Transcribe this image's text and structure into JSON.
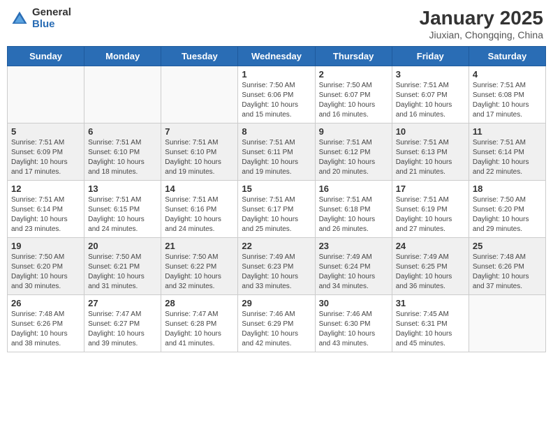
{
  "header": {
    "logo_general": "General",
    "logo_blue": "Blue",
    "title": "January 2025",
    "location": "Jiuxian, Chongqing, China"
  },
  "weekdays": [
    "Sunday",
    "Monday",
    "Tuesday",
    "Wednesday",
    "Thursday",
    "Friday",
    "Saturday"
  ],
  "weeks": [
    [
      {
        "day": "",
        "info": ""
      },
      {
        "day": "",
        "info": ""
      },
      {
        "day": "",
        "info": ""
      },
      {
        "day": "1",
        "info": "Sunrise: 7:50 AM\nSunset: 6:06 PM\nDaylight: 10 hours and 15 minutes."
      },
      {
        "day": "2",
        "info": "Sunrise: 7:50 AM\nSunset: 6:07 PM\nDaylight: 10 hours and 16 minutes."
      },
      {
        "day": "3",
        "info": "Sunrise: 7:51 AM\nSunset: 6:07 PM\nDaylight: 10 hours and 16 minutes."
      },
      {
        "day": "4",
        "info": "Sunrise: 7:51 AM\nSunset: 6:08 PM\nDaylight: 10 hours and 17 minutes."
      }
    ],
    [
      {
        "day": "5",
        "info": "Sunrise: 7:51 AM\nSunset: 6:09 PM\nDaylight: 10 hours and 17 minutes."
      },
      {
        "day": "6",
        "info": "Sunrise: 7:51 AM\nSunset: 6:10 PM\nDaylight: 10 hours and 18 minutes."
      },
      {
        "day": "7",
        "info": "Sunrise: 7:51 AM\nSunset: 6:10 PM\nDaylight: 10 hours and 19 minutes."
      },
      {
        "day": "8",
        "info": "Sunrise: 7:51 AM\nSunset: 6:11 PM\nDaylight: 10 hours and 19 minutes."
      },
      {
        "day": "9",
        "info": "Sunrise: 7:51 AM\nSunset: 6:12 PM\nDaylight: 10 hours and 20 minutes."
      },
      {
        "day": "10",
        "info": "Sunrise: 7:51 AM\nSunset: 6:13 PM\nDaylight: 10 hours and 21 minutes."
      },
      {
        "day": "11",
        "info": "Sunrise: 7:51 AM\nSunset: 6:14 PM\nDaylight: 10 hours and 22 minutes."
      }
    ],
    [
      {
        "day": "12",
        "info": "Sunrise: 7:51 AM\nSunset: 6:14 PM\nDaylight: 10 hours and 23 minutes."
      },
      {
        "day": "13",
        "info": "Sunrise: 7:51 AM\nSunset: 6:15 PM\nDaylight: 10 hours and 24 minutes."
      },
      {
        "day": "14",
        "info": "Sunrise: 7:51 AM\nSunset: 6:16 PM\nDaylight: 10 hours and 24 minutes."
      },
      {
        "day": "15",
        "info": "Sunrise: 7:51 AM\nSunset: 6:17 PM\nDaylight: 10 hours and 25 minutes."
      },
      {
        "day": "16",
        "info": "Sunrise: 7:51 AM\nSunset: 6:18 PM\nDaylight: 10 hours and 26 minutes."
      },
      {
        "day": "17",
        "info": "Sunrise: 7:51 AM\nSunset: 6:19 PM\nDaylight: 10 hours and 27 minutes."
      },
      {
        "day": "18",
        "info": "Sunrise: 7:50 AM\nSunset: 6:20 PM\nDaylight: 10 hours and 29 minutes."
      }
    ],
    [
      {
        "day": "19",
        "info": "Sunrise: 7:50 AM\nSunset: 6:20 PM\nDaylight: 10 hours and 30 minutes."
      },
      {
        "day": "20",
        "info": "Sunrise: 7:50 AM\nSunset: 6:21 PM\nDaylight: 10 hours and 31 minutes."
      },
      {
        "day": "21",
        "info": "Sunrise: 7:50 AM\nSunset: 6:22 PM\nDaylight: 10 hours and 32 minutes."
      },
      {
        "day": "22",
        "info": "Sunrise: 7:49 AM\nSunset: 6:23 PM\nDaylight: 10 hours and 33 minutes."
      },
      {
        "day": "23",
        "info": "Sunrise: 7:49 AM\nSunset: 6:24 PM\nDaylight: 10 hours and 34 minutes."
      },
      {
        "day": "24",
        "info": "Sunrise: 7:49 AM\nSunset: 6:25 PM\nDaylight: 10 hours and 36 minutes."
      },
      {
        "day": "25",
        "info": "Sunrise: 7:48 AM\nSunset: 6:26 PM\nDaylight: 10 hours and 37 minutes."
      }
    ],
    [
      {
        "day": "26",
        "info": "Sunrise: 7:48 AM\nSunset: 6:26 PM\nDaylight: 10 hours and 38 minutes."
      },
      {
        "day": "27",
        "info": "Sunrise: 7:47 AM\nSunset: 6:27 PM\nDaylight: 10 hours and 39 minutes."
      },
      {
        "day": "28",
        "info": "Sunrise: 7:47 AM\nSunset: 6:28 PM\nDaylight: 10 hours and 41 minutes."
      },
      {
        "day": "29",
        "info": "Sunrise: 7:46 AM\nSunset: 6:29 PM\nDaylight: 10 hours and 42 minutes."
      },
      {
        "day": "30",
        "info": "Sunrise: 7:46 AM\nSunset: 6:30 PM\nDaylight: 10 hours and 43 minutes."
      },
      {
        "day": "31",
        "info": "Sunrise: 7:45 AM\nSunset: 6:31 PM\nDaylight: 10 hours and 45 minutes."
      },
      {
        "day": "",
        "info": ""
      }
    ]
  ]
}
